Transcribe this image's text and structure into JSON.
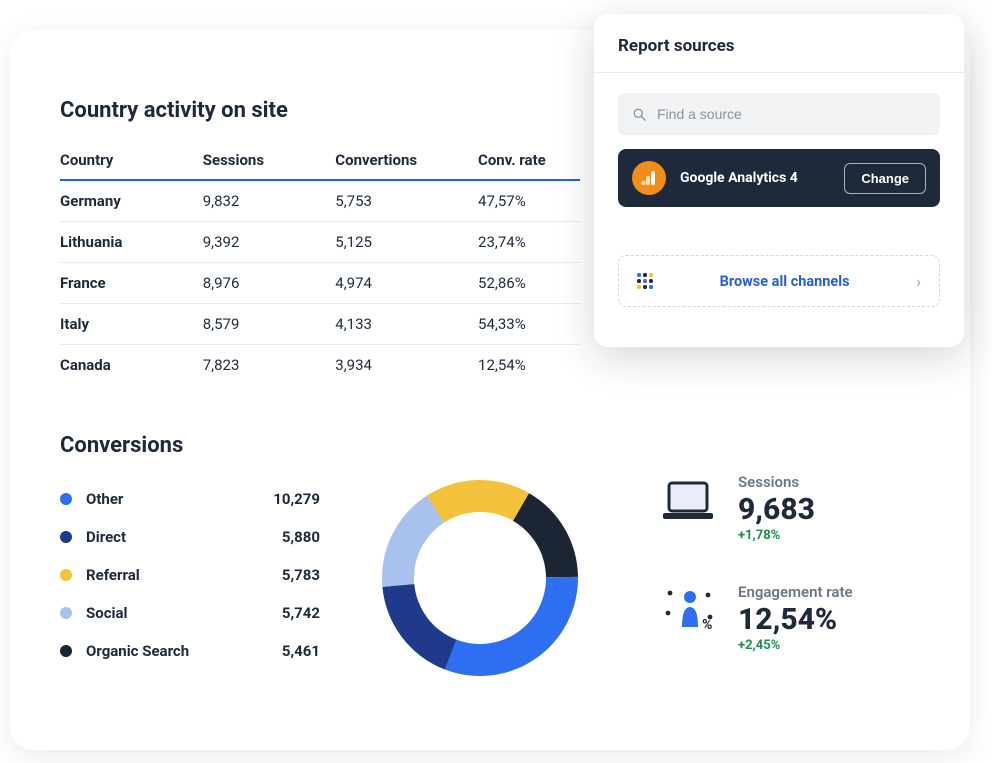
{
  "country_section": {
    "title": "Country activity on site",
    "headers": [
      "Country",
      "Sessions",
      "Convertions",
      "Conv. rate"
    ],
    "rows": [
      {
        "country": "Germany",
        "sessions": "9,832",
        "conversions": "5,753",
        "rate": "47,57%"
      },
      {
        "country": "Lithuania",
        "sessions": "9,392",
        "conversions": "5,125",
        "rate": "23,74%"
      },
      {
        "country": "France",
        "sessions": "8,976",
        "conversions": "4,974",
        "rate": "52,86%"
      },
      {
        "country": "Italy",
        "sessions": "8,579",
        "conversions": "4,133",
        "rate": "54,33%"
      },
      {
        "country": "Canada",
        "sessions": "7,823",
        "conversions": "3,934",
        "rate": "12,54%"
      }
    ]
  },
  "conversions": {
    "title": "Conversions",
    "items": [
      {
        "label": "Other",
        "value": "10,279",
        "num": 10279,
        "color": "#2d6ff0"
      },
      {
        "label": "Direct",
        "value": "5,880",
        "num": 5880,
        "color": "#1f3a8a"
      },
      {
        "label": "Referral",
        "value": "5,783",
        "num": 5783,
        "color": "#f3c23a"
      },
      {
        "label": "Social",
        "value": "5,742",
        "num": 5742,
        "color": "#a9c1ef"
      },
      {
        "label": "Organic Search",
        "value": "5,461",
        "num": 5461,
        "color": "#1b2533"
      }
    ]
  },
  "kpis": {
    "sessions": {
      "label": "Sessions",
      "value": "9,683",
      "change": "+1,78%"
    },
    "engagement": {
      "label": "Engagement rate",
      "value": "12,54%",
      "change": "+2,45%"
    }
  },
  "sources_panel": {
    "title": "Report sources",
    "search_placeholder": "Find a source",
    "ga4_label": "Google Analytics 4",
    "change_label": "Change",
    "browse_label": "Browse all channels"
  },
  "chart_data": {
    "type": "pie",
    "title": "Conversions",
    "series": [
      {
        "name": "Other",
        "value": 10279,
        "color": "#2d6ff0"
      },
      {
        "name": "Direct",
        "value": 5880,
        "color": "#1f3a8a"
      },
      {
        "name": "Referral",
        "value": 5783,
        "color": "#f3c23a"
      },
      {
        "name": "Social",
        "value": 5742,
        "color": "#a9c1ef"
      },
      {
        "name": "Organic Search",
        "value": 5461,
        "color": "#1b2533"
      }
    ],
    "donut": true
  }
}
